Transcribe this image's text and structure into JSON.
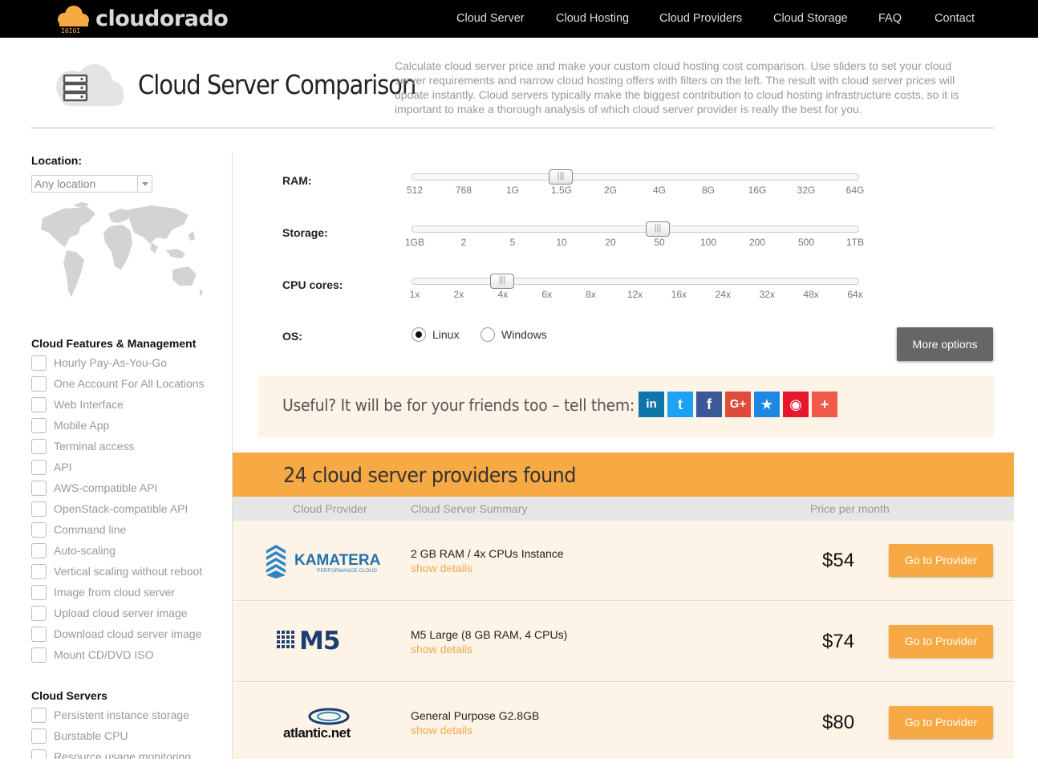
{
  "brand": {
    "name": "cloudorado",
    "accent": "#f7a944"
  },
  "nav": [
    "Cloud Server",
    "Cloud Hosting",
    "Cloud Providers",
    "Cloud Storage",
    "FAQ",
    "Contact"
  ],
  "header": {
    "icon": "server-cloud-icon",
    "title": "Cloud Server Comparison",
    "description": "Calculate cloud server price and make your custom cloud hosting cost comparison. Use sliders to set your cloud server requirements and narrow cloud hosting offers with filters on the left. The result with cloud server prices will update instantly. Cloud servers typically make the biggest contribution to cloud hosting infrastructure costs, so it is important to make a thorough analysis of which cloud server provider is really the best for you."
  },
  "sidebar": {
    "location_label": "Location:",
    "location_value": "Any location",
    "map_icon": "world-map-icon",
    "features_heading": "Cloud Features & Management",
    "features": [
      "Hourly Pay-As-You-Go",
      "One Account For All Locations",
      "Web Interface",
      "Mobile App",
      "Terminal access",
      "API",
      "AWS-compatible API",
      "OpenStack-compatible API",
      "Command line",
      "Auto-scaling",
      "Vertical scaling without reboot",
      "Image from cloud server",
      "Upload cloud server image",
      "Download cloud server image",
      "Mount CD/DVD ISO"
    ],
    "servers_heading": "Cloud Servers",
    "servers": [
      "Persistent instance storage",
      "Burstable CPU",
      "Resource usage monitoring"
    ]
  },
  "sliders": {
    "ram": {
      "label": "RAM:",
      "ticks": [
        "512",
        "768",
        "1G",
        "1.5G",
        "2G",
        "4G",
        "8G",
        "16G",
        "32G",
        "64G"
      ],
      "value": "1.5G"
    },
    "storage": {
      "label": "Storage:",
      "ticks": [
        "1GB",
        "2",
        "5",
        "10",
        "20",
        "50",
        "100",
        "200",
        "500",
        "1TB"
      ],
      "value": "50"
    },
    "cpu": {
      "label": "CPU cores:",
      "ticks": [
        "1x",
        "2x",
        "4x",
        "6x",
        "8x",
        "12x",
        "16x",
        "24x",
        "32x",
        "48x",
        "64x"
      ],
      "value": "4x"
    }
  },
  "os": {
    "label": "OS:",
    "options": [
      "Linux",
      "Windows"
    ],
    "selected": "Linux"
  },
  "more_options": "More options",
  "share": {
    "text": "Useful? It will be for your friends too – tell them:",
    "icons": [
      {
        "name": "linkedin-icon",
        "glyph": "in",
        "color": "#0e76a8"
      },
      {
        "name": "twitter-icon",
        "glyph": "t",
        "color": "#1da1f2"
      },
      {
        "name": "facebook-icon",
        "glyph": "f",
        "color": "#3b5998"
      },
      {
        "name": "google-plus-icon",
        "glyph": "G+",
        "color": "#dd4b39"
      },
      {
        "name": "bookmark-star-icon",
        "glyph": "★",
        "color": "#1e88e5"
      },
      {
        "name": "weibo-icon",
        "glyph": "◉",
        "color": "#e6162d"
      },
      {
        "name": "more-share-icon",
        "glyph": "+",
        "color": "#f15a4a"
      }
    ]
  },
  "results": {
    "found": "24 cloud server providers found",
    "columns": [
      "Cloud Provider",
      "Cloud Server Summary",
      "Price per month"
    ],
    "rows": [
      {
        "provider": "KAMATERA",
        "provider_sub": "PERFORMANCE CLOUD",
        "summary": "2 GB RAM / 4x CPUs Instance",
        "details": "show details",
        "price": "$54",
        "button": "Go to Provider"
      },
      {
        "provider": "M5",
        "summary": "M5 Large (8 GB RAM, 4 CPUs)",
        "details": "show details",
        "price": "$74",
        "button": "Go to Provider"
      },
      {
        "provider": "atlantic.net",
        "summary": "General Purpose G2.8GB",
        "details": "show details",
        "price": "$80",
        "button": "Go to Provider"
      }
    ]
  }
}
